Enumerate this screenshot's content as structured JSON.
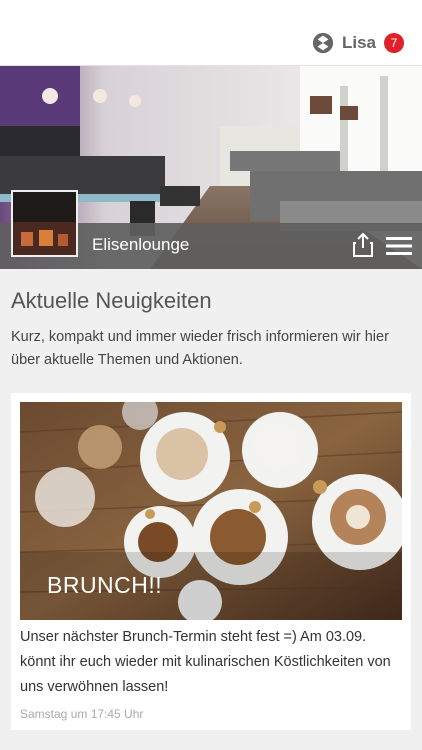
{
  "header": {
    "user_name": "Lisa",
    "notification_count": "7",
    "user_icon": "app-logo-icon"
  },
  "venue": {
    "name": "Elisenlounge",
    "logo_label": "ELISENLOUNGE",
    "share_icon": "share-icon",
    "menu_icon": "hamburger-menu-icon"
  },
  "news": {
    "title": "Aktuelle Neuigkeiten",
    "description": "Kurz, kompakt und immer wieder frisch informieren wir hier über aktuelle Themen und Aktionen."
  },
  "post": {
    "image_title": "BRUNCH!!",
    "body": "Unser nächster Brunch-Termin steht fest =) Am 03.09. könnt ihr euch wieder mit kulinarischen Köstlichkeiten von uns verwöhnen lassen!",
    "timestamp": "Samstag um 17:45 Uhr"
  },
  "colors": {
    "badge": "#e0202a",
    "hero_bar": "#5f5f5f",
    "background": "#f0f0f0"
  }
}
